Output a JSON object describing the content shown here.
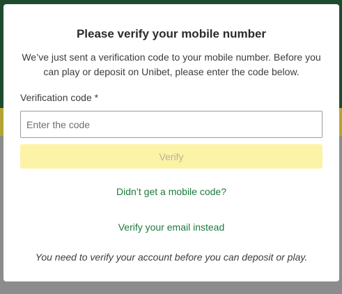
{
  "modal": {
    "title": "Please verify your mobile number",
    "description": "We’ve just sent a verification code to your mobile number. Before you can play or deposit on Unibet, please enter the code below.",
    "field_label": "Verification code *",
    "input_placeholder": "Enter the code",
    "input_value": "",
    "verify_label": "Verify",
    "resend_link": "Didn’t get a mobile code?",
    "email_link": "Verify your email instead",
    "footnote": "You need to verify your account before you can deposit or play."
  },
  "colors": {
    "accent_link": "#1c7a3c",
    "verify_button_disabled": "#fdf3a6",
    "backdrop_header": "#1f4a2e",
    "backdrop_yellow": "#b3a533"
  }
}
